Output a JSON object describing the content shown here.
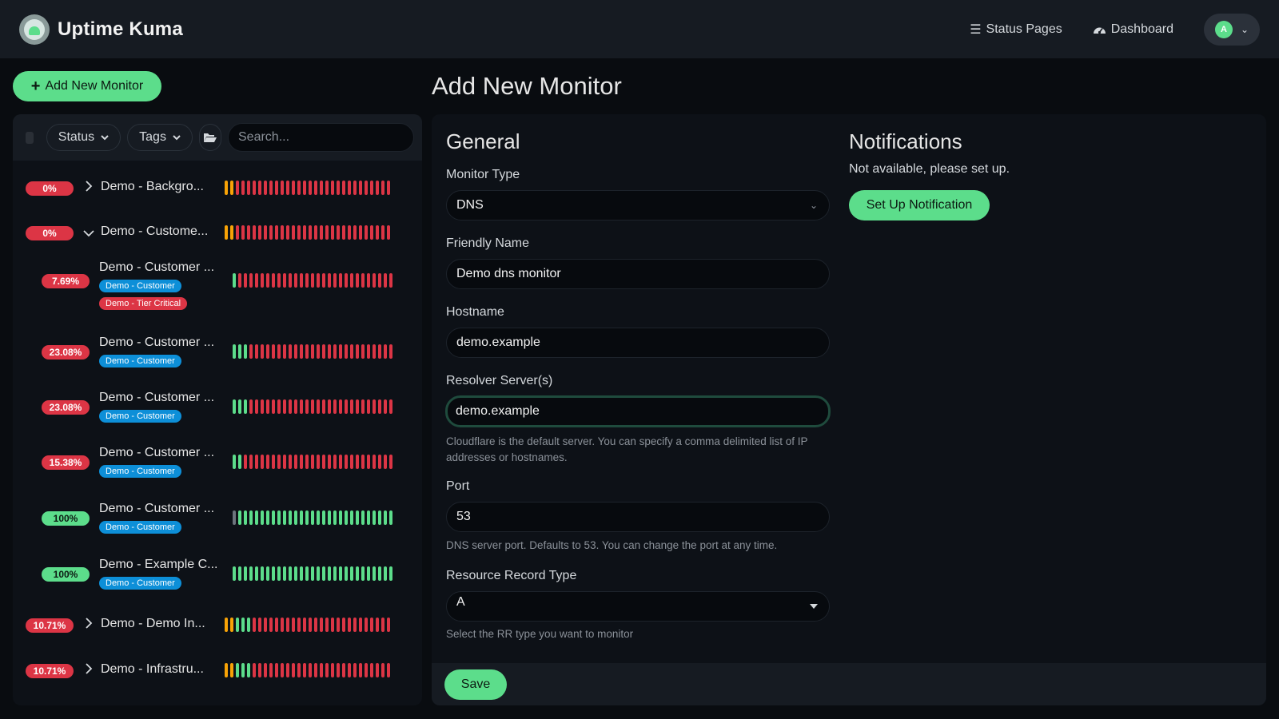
{
  "header": {
    "brand": "Uptime Kuma",
    "nav": [
      {
        "label": "Status Pages",
        "icon": "list-icon"
      },
      {
        "label": "Dashboard",
        "icon": "gauge-icon"
      }
    ],
    "avatar_initial": "A"
  },
  "sidebar": {
    "add_button": "Add New Monitor",
    "filters": {
      "status": "Status",
      "tags": "Tags"
    },
    "search_placeholder": "Search...",
    "monitors": [
      {
        "pct": "0%",
        "status": "down",
        "name": "Demo - Backgro...",
        "group": true,
        "expanded": false,
        "tags": []
      },
      {
        "pct": "0%",
        "status": "down",
        "name": "Demo - Custome...",
        "group": true,
        "expanded": true,
        "tags": []
      },
      {
        "pct": "7.69%",
        "status": "down",
        "name": "Demo - Customer ...",
        "group": false,
        "tags": [
          {
            "label": "Demo - Customer",
            "color": "#0d8fd8"
          },
          {
            "label": "Demo - Tier Critical",
            "color": "#dc3545"
          }
        ]
      },
      {
        "pct": "23.08%",
        "status": "down",
        "name": "Demo - Customer ...",
        "group": false,
        "tags": [
          {
            "label": "Demo - Customer",
            "color": "#0d8fd8"
          }
        ]
      },
      {
        "pct": "23.08%",
        "status": "down",
        "name": "Demo - Customer ...",
        "group": false,
        "tags": [
          {
            "label": "Demo - Customer",
            "color": "#0d8fd8"
          }
        ]
      },
      {
        "pct": "15.38%",
        "status": "down",
        "name": "Demo - Customer ...",
        "group": false,
        "tags": [
          {
            "label": "Demo - Customer",
            "color": "#0d8fd8"
          }
        ]
      },
      {
        "pct": "100%",
        "status": "up",
        "name": "Demo - Customer ...",
        "group": false,
        "tags": [
          {
            "label": "Demo - Customer",
            "color": "#0d8fd8"
          }
        ]
      },
      {
        "pct": "100%",
        "status": "up",
        "name": "Demo - Example C...",
        "group": false,
        "tags": [
          {
            "label": "Demo - Customer",
            "color": "#0d8fd8"
          }
        ]
      },
      {
        "pct": "10.71%",
        "status": "down",
        "name": "Demo - Demo In...",
        "group": true,
        "expanded": false,
        "tags": []
      },
      {
        "pct": "10.71%",
        "status": "down",
        "name": "Demo - Infrastru...",
        "group": true,
        "expanded": false,
        "tags": []
      }
    ]
  },
  "main": {
    "title": "Add New Monitor",
    "general": {
      "heading": "General",
      "monitor_type_label": "Monitor Type",
      "monitor_type_value": "DNS",
      "friendly_name_label": "Friendly Name",
      "friendly_name_value": "Demo dns monitor",
      "hostname_label": "Hostname",
      "hostname_value": "demo.example",
      "resolver_label": "Resolver Server(s)",
      "resolver_value": "demo.example",
      "resolver_help_1": "Cloudflare is the default server. You can specify a comma delimited list of IP",
      "resolver_help_2": "addresses or hostnames.",
      "port_label": "Port",
      "port_value": "53",
      "port_help": "DNS server port. Defaults to 53. You can change the port at any time.",
      "rr_label": "Resource Record Type",
      "rr_value": "A",
      "rr_help": "Select the RR type you want to monitor"
    },
    "notifications": {
      "heading": "Notifications",
      "text": "Not available, please set up.",
      "button": "Set Up Notification"
    },
    "save_label": "Save"
  },
  "colors": {
    "accent": "#5cdd8b",
    "down": "#dc3545",
    "pending": "#f8a306",
    "tag_blue": "#0d8fd8"
  }
}
